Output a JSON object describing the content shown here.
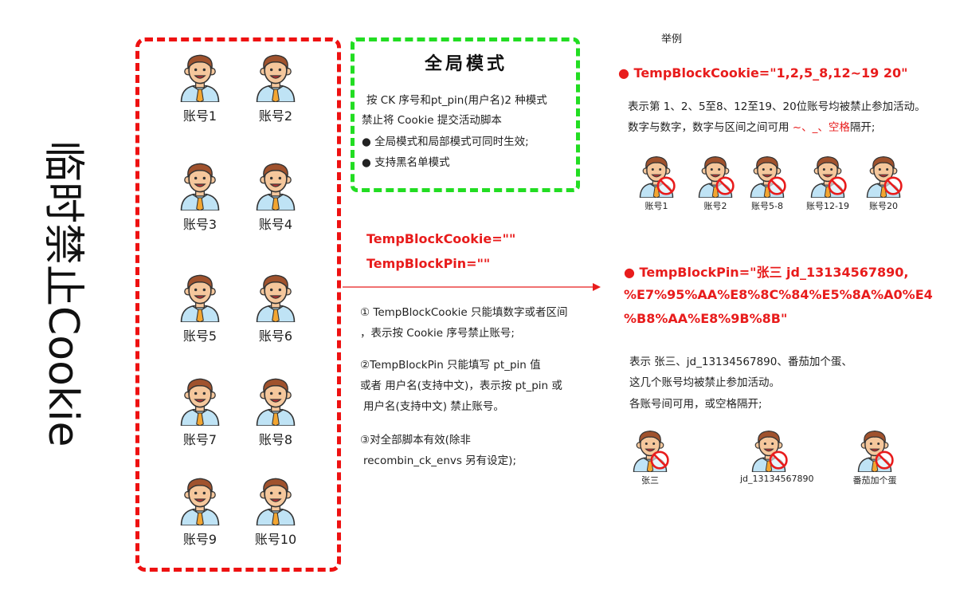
{
  "title": "临时禁止Cookie",
  "accounts": [
    "账号1",
    "账号2",
    "账号3",
    "账号4",
    "账号5",
    "账号6",
    "账号7",
    "账号8",
    "账号9",
    "账号10"
  ],
  "global_mode": {
    "title": "全局模式",
    "line1": "按 CK 序号和pt_pin(用户名)2 种模式",
    "line2": "禁止将 Cookie 提交活动脚本",
    "bullet1": "● 全局模式和局部模式可同时生效;",
    "bullet2": "● 支持黑名单模式"
  },
  "center": {
    "code1": "TempBlockCookie=\"\"",
    "code2": "TempBlockPin=\"\"",
    "note1_line1": "① TempBlockCookie 只能填数字或者区间",
    "note1_line2": "，表示按 Cookie 序号禁止账号;",
    "note2_line1": "②TempBlockPin 只能填写 pt_pin 值",
    "note2_line2": "或者 用户名(支持中文)，表示按 pt_pin 或",
    "note2_line3": "用户名(支持中文) 禁止账号。",
    "note3_line1": "③对全部脚本有效(除非",
    "note3_line2": "recombin_ck_envs 另有设定);"
  },
  "example": {
    "heading": "举例",
    "cookie_code": "● TempBlockCookie=\"1,2,5_8,12~19 20\"",
    "cookie_desc1": "表示第 1、2、5至8、12至19、20位账号均被禁止参加活动。",
    "cookie_desc2_a": "数字与数字，数字与区间之间可用 ",
    "cookie_desc2_sep": "~、_、空格",
    "cookie_desc2_b": "隔开;",
    "cookie_accounts": [
      "账号1",
      "账号2",
      "账号5-8",
      "账号12-19",
      "账号20"
    ],
    "pin_code1": "● TempBlockPin=\"张三 jd_13134567890,",
    "pin_code2": "%E7%95%AA%E8%8C%84%E5%8A%A0%E4",
    "pin_code3": "%B8%AA%E8%9B%8B\"",
    "pin_desc1": "表示 张三、jd_13134567890、番茄加个蛋、",
    "pin_desc2": "这几个账号均被禁止参加活动。",
    "pin_desc3": "各账号间可用，或空格隔开;",
    "pin_accounts": [
      "张三",
      "jd_13134567890",
      "番茄加个蛋"
    ]
  },
  "colors": {
    "red": "#e81c1c",
    "green": "#22dd22",
    "skin": "#f5c79c",
    "hair": "#a0522d",
    "shirt": "#bfe3f5",
    "tie": "#f2a531"
  }
}
